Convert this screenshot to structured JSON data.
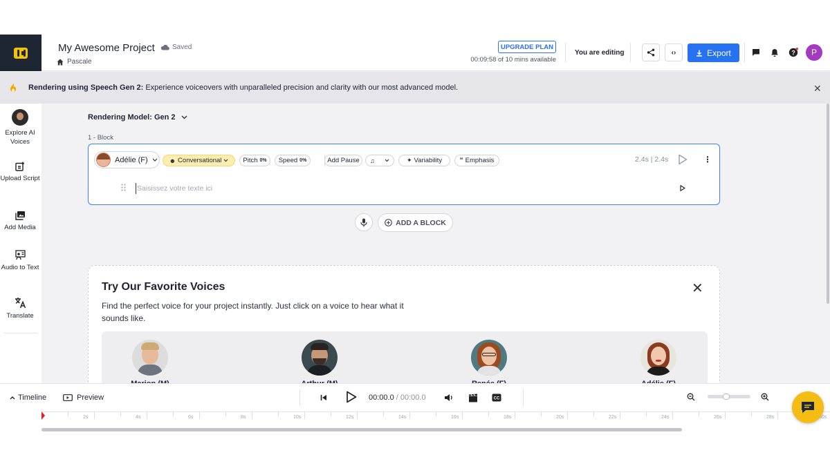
{
  "header": {
    "project_title": "My Awesome Project",
    "saved_label": "Saved",
    "breadcrumb": "Pascale",
    "upgrade_label": "UPGRADE PLAN",
    "usage": "00:09:58 of 10 mins available",
    "editing_label": "You are editing",
    "export_label": "Export",
    "avatar_initial": "P",
    "accent_color": "#2672f2"
  },
  "banner": {
    "bold": "Rendering using Speech Gen 2:",
    "text": " Experience voiceovers with unparalleled precision and clarity with our most advanced model."
  },
  "sidebar": {
    "items": [
      {
        "label": "Explore AI Voices",
        "icon": "voice-avatar-icon"
      },
      {
        "label": "Upload Script",
        "icon": "upload-script-icon"
      },
      {
        "label": "Add Media",
        "icon": "media-icon"
      },
      {
        "label": "Audio to Text",
        "icon": "audio-to-text-icon"
      },
      {
        "label": "Translate",
        "icon": "translate-icon"
      }
    ]
  },
  "editor": {
    "model_label": "Rendering Model: Gen 2",
    "block_label": "1 -  Block",
    "voice": "Adélie (F)",
    "style": "Conversational",
    "pitch_label": "Pitch",
    "pitch_value": "0%",
    "speed_label": "Speed",
    "speed_value": "0%",
    "add_pause": "Add Pause",
    "variability": "Variability",
    "emphasis": "Emphasis",
    "duration": "2.4s | 2.4s",
    "text_placeholder": "Saisissez votre texte ici",
    "add_block_label": "ADD A BLOCK"
  },
  "favorites": {
    "title": "Try Our Favorite Voices",
    "description": "Find the perfect voice for your project instantly. Just click on a voice to hear what it sounds like.",
    "voices": [
      {
        "name": "Marion (M)"
      },
      {
        "name": "Arthur (M)"
      },
      {
        "name": "Renée (F)"
      },
      {
        "name": "Adélie (F)"
      }
    ]
  },
  "timeline": {
    "toggle_label": "Timeline",
    "preview_label": "Preview",
    "current_time": "00:00.0",
    "total_time": " / 00:00.0",
    "ticks": [
      "2s",
      "4s",
      "6s",
      "8s",
      "10s",
      "12s",
      "14s",
      "16s",
      "18s",
      "20s",
      "22s",
      "24s",
      "26s",
      "28s",
      "30s"
    ]
  }
}
